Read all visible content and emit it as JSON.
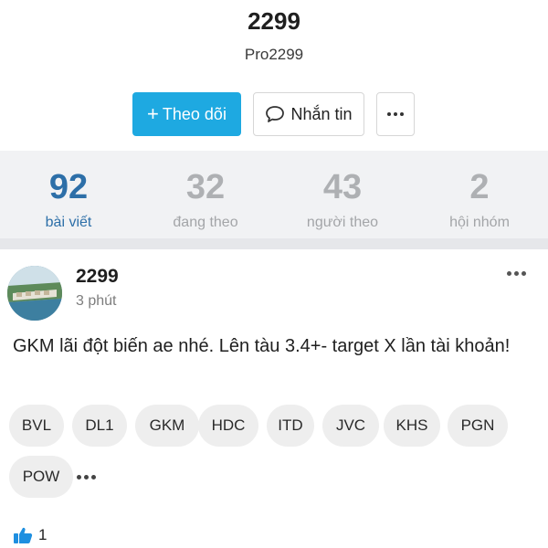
{
  "profile": {
    "name": "2299",
    "handle": "Pro2299",
    "follow_label": "Theo dõi",
    "message_label": "Nhắn tin"
  },
  "stats": [
    {
      "value": "92",
      "label": "bài viết",
      "active": true
    },
    {
      "value": "32",
      "label": "đang theo",
      "active": false
    },
    {
      "value": "43",
      "label": "người theo",
      "active": false
    },
    {
      "value": "2",
      "label": "hội nhóm",
      "active": false
    }
  ],
  "post": {
    "author": "2299",
    "time": "3 phút",
    "text": "GKM lãi đột biến ae nhé. Lên tàu 3.4+- target X lần tài khoản!",
    "tags": [
      "BVL",
      "DL1",
      "GKM",
      "HDC",
      "ITD",
      "JVC",
      "KHS",
      "PGN",
      "POW"
    ],
    "like_count": "1"
  },
  "colors": {
    "accent": "#1ea9e1",
    "active_stat": "#2d6fa8",
    "like_icon": "#1e8fe0"
  },
  "icons": {
    "follow": "plus-icon",
    "message": "chat-bubble-icon",
    "more": "more-dots-icon",
    "like": "thumbs-up-icon"
  }
}
